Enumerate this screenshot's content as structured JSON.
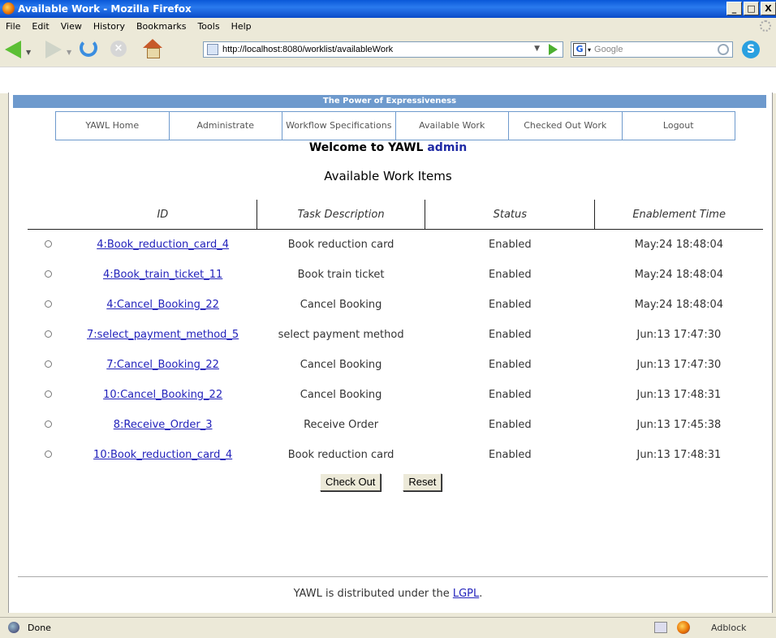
{
  "window": {
    "title": "Available Work - Mozilla Firefox",
    "min": "_",
    "max": "□",
    "close": "X"
  },
  "menu": [
    "File",
    "Edit",
    "View",
    "History",
    "Bookmarks",
    "Tools",
    "Help"
  ],
  "toolbar": {
    "url": "http://localhost:8080/worklist/availableWork",
    "search_placeholder": "Google"
  },
  "banner": "The Power of Expressiveness",
  "nav": [
    "YAWL Home",
    "Administrate",
    "Workflow Specifications",
    "Available Work",
    "Checked Out Work",
    "Logout"
  ],
  "welcome": {
    "text": "Welcome to YAWL ",
    "user": "admin"
  },
  "heading": "Available Work Items",
  "columns": [
    "ID",
    "Task Description",
    "Status",
    "Enablement Time"
  ],
  "rows": [
    {
      "id": "4:Book_reduction_card_4",
      "task": "Book reduction card",
      "status": "Enabled",
      "time": "May:24 18:48:04"
    },
    {
      "id": "4:Book_train_ticket_11",
      "task": "Book train ticket",
      "status": "Enabled",
      "time": "May:24 18:48:04"
    },
    {
      "id": "4:Cancel_Booking_22",
      "task": "Cancel Booking",
      "status": "Enabled",
      "time": "May:24 18:48:04"
    },
    {
      "id": "7:select_payment_method_5",
      "task": "select payment method",
      "status": "Enabled",
      "time": "Jun:13 17:47:30"
    },
    {
      "id": "7:Cancel_Booking_22",
      "task": "Cancel Booking",
      "status": "Enabled",
      "time": "Jun:13 17:47:30"
    },
    {
      "id": "10:Cancel_Booking_22",
      "task": "Cancel Booking",
      "status": "Enabled",
      "time": "Jun:13 17:48:31"
    },
    {
      "id": "8:Receive_Order_3",
      "task": "Receive Order",
      "status": "Enabled",
      "time": "Jun:13 17:45:38"
    },
    {
      "id": "10:Book_reduction_card_4",
      "task": "Book reduction card",
      "status": "Enabled",
      "time": "Jun:13 17:48:31"
    }
  ],
  "buttons": {
    "checkout": "Check Out",
    "reset": "Reset"
  },
  "footer": {
    "text": "YAWL is distributed under the ",
    "link": "LGPL",
    "end": "."
  },
  "status": {
    "text": "Done",
    "adblock": "Adblock"
  }
}
